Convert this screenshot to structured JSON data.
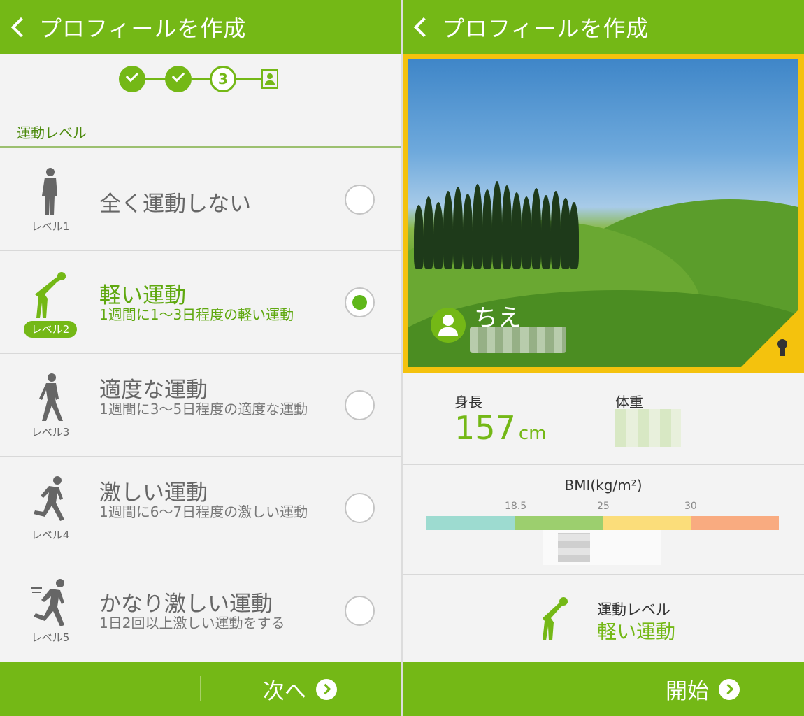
{
  "left": {
    "appbar_title": "プロフィールを作成",
    "step_current": "3",
    "section_label": "運動レベル",
    "levels": [
      {
        "level": "レベル1",
        "title": "全く運動しない",
        "desc": ""
      },
      {
        "level": "レベル2",
        "title": "軽い運動",
        "desc": "1週間に1〜3日程度の軽い運動"
      },
      {
        "level": "レベル3",
        "title": "適度な運動",
        "desc": "1週間に3〜5日程度の適度な運動"
      },
      {
        "level": "レベル4",
        "title": "激しい運動",
        "desc": "1週間に6〜7日程度の激しい運動"
      },
      {
        "level": "レベル5",
        "title": "かなり激しい運動",
        "desc": "1日2回以上激しい運動をする"
      }
    ],
    "selected_level": "レベル2",
    "next_label": "次へ"
  },
  "right": {
    "appbar_title": "プロフィールを作成",
    "profile_name": "ちえ",
    "height_label": "身長",
    "height_value": "157",
    "height_unit": "cm",
    "weight_label": "体重",
    "bmi_title": "BMI(kg/m²)",
    "bmi_ticks": [
      "18.5",
      "25",
      "30"
    ],
    "exercise_label": "運動レベル",
    "exercise_value": "軽い運動",
    "start_label": "開始"
  },
  "colors": {
    "brand_green": "#74b816",
    "bmi_under": "#9ddbd0",
    "bmi_normal": "#9ccf6e",
    "bmi_over": "#fbdd7a",
    "bmi_obese": "#f9ab80",
    "frame_gold": "#f4c20d"
  },
  "icons": [
    "back-icon",
    "check-icon",
    "profile-card-icon",
    "figure-icon",
    "radio-icon",
    "arrow-right-icon",
    "avatar-icon",
    "lock-icon"
  ]
}
